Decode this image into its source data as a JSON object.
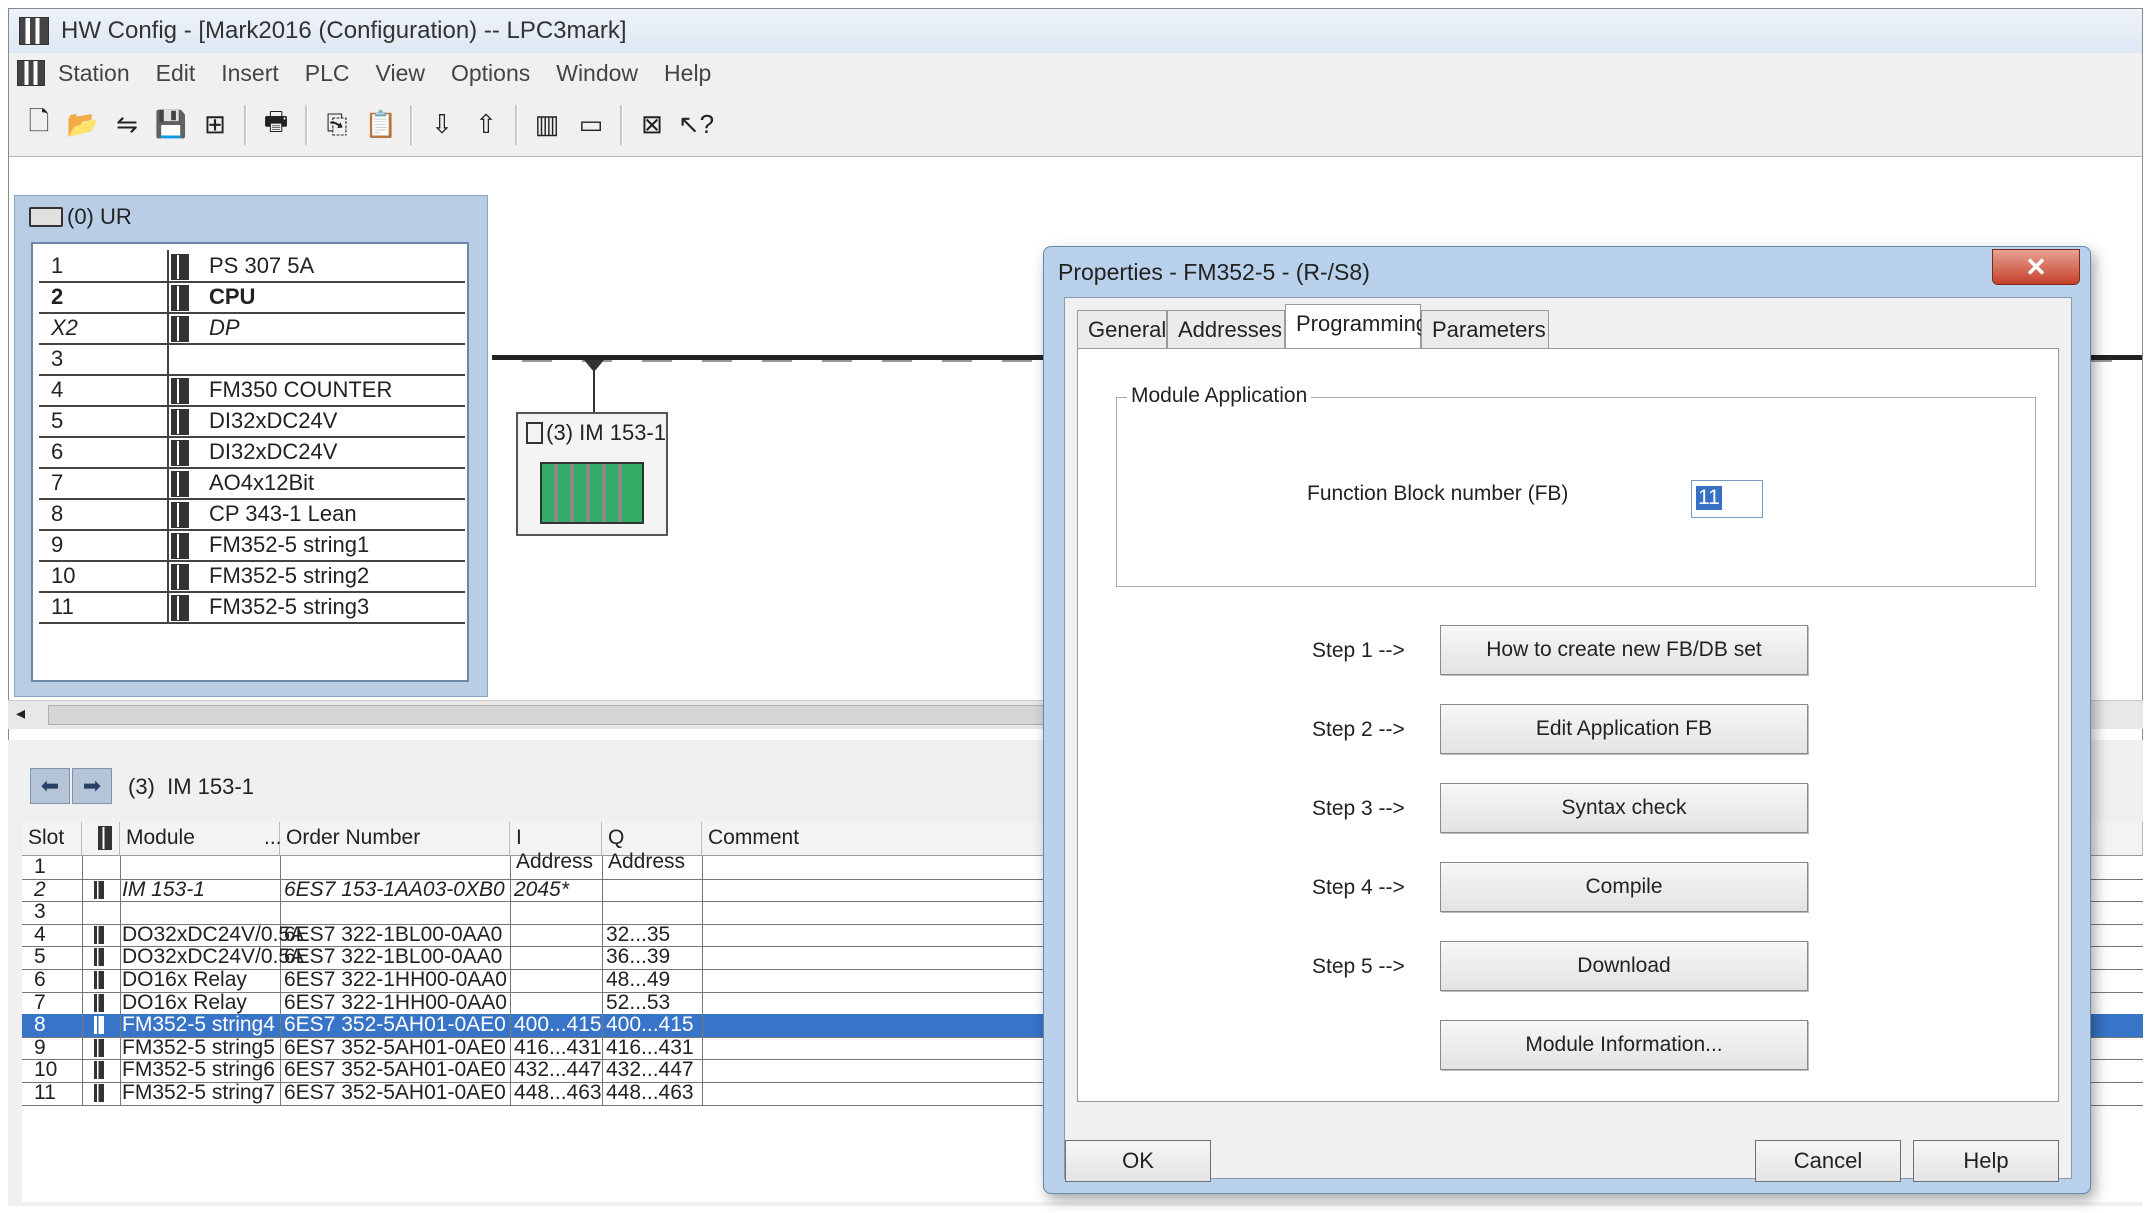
{
  "window": {
    "title": "HW Config - [Mark2016 (Configuration) -- LPC3mark]"
  },
  "menu": [
    "Station",
    "Edit",
    "Insert",
    "PLC",
    "View",
    "Options",
    "Window",
    "Help"
  ],
  "toolbar": [
    {
      "name": "new-icon",
      "glyph": "🗋"
    },
    {
      "name": "open-icon",
      "glyph": "📂"
    },
    {
      "name": "network-icon",
      "glyph": "⇋"
    },
    {
      "name": "save-icon",
      "glyph": "💾"
    },
    {
      "name": "save-compile-icon",
      "glyph": "⊞"
    },
    {
      "name": "sep"
    },
    {
      "name": "print-icon",
      "glyph": "🖶"
    },
    {
      "name": "sep"
    },
    {
      "name": "copy-icon",
      "glyph": "⎘"
    },
    {
      "name": "paste-icon",
      "glyph": "📋"
    },
    {
      "name": "sep"
    },
    {
      "name": "download-icon",
      "glyph": "⇩"
    },
    {
      "name": "upload-icon",
      "glyph": "⇧"
    },
    {
      "name": "sep"
    },
    {
      "name": "catalog-icon",
      "glyph": "▥"
    },
    {
      "name": "display-icon",
      "glyph": "▭"
    },
    {
      "name": "sep"
    },
    {
      "name": "netpro-icon",
      "glyph": "⊠"
    },
    {
      "name": "help-icon",
      "glyph": "↖?"
    }
  ],
  "rack": {
    "title": "(0) UR",
    "rows": [
      {
        "slot": "1",
        "module": "PS 307 5A"
      },
      {
        "slot": "2",
        "module": "CPU"
      },
      {
        "slot": "X2",
        "module": "DP"
      },
      {
        "slot": "3",
        "module": ""
      },
      {
        "slot": "4",
        "module": "FM350 COUNTER"
      },
      {
        "slot": "5",
        "module": "DI32xDC24V"
      },
      {
        "slot": "6",
        "module": "DI32xDC24V"
      },
      {
        "slot": "7",
        "module": "AO4x12Bit"
      },
      {
        "slot": "8",
        "module": "CP 343-1 Lean"
      },
      {
        "slot": "9",
        "module": "FM352-5 string1"
      },
      {
        "slot": "10",
        "module": "FM352-5 string2"
      },
      {
        "slot": "11",
        "module": "FM352-5 string3"
      }
    ]
  },
  "device": {
    "label": "(3) IM 153-1"
  },
  "lower": {
    "breadcrumb_num": "(3)",
    "breadcrumb_name": "IM 153-1",
    "headers": [
      "Slot",
      "",
      "Module",
      "...",
      "Order Number",
      "I Address",
      "Q Address",
      "Comment"
    ],
    "rows": [
      {
        "slot": "1",
        "module": "",
        "order": "",
        "i": "",
        "q": "",
        "style": ""
      },
      {
        "slot": "2",
        "module": "IM 153-1",
        "order": "6ES7 153-1AA03-0XB0",
        "i": "2045*",
        "q": "",
        "style": "it"
      },
      {
        "slot": "3",
        "module": "",
        "order": "",
        "i": "",
        "q": "",
        "style": ""
      },
      {
        "slot": "4",
        "module": "DO32xDC24V/0.5A",
        "order": "6ES7 322-1BL00-0AA0",
        "i": "",
        "q": "32...35",
        "style": ""
      },
      {
        "slot": "5",
        "module": "DO32xDC24V/0.5A",
        "order": "6ES7 322-1BL00-0AA0",
        "i": "",
        "q": "36...39",
        "style": ""
      },
      {
        "slot": "6",
        "module": "DO16x Relay",
        "order": "6ES7 322-1HH00-0AA0",
        "i": "",
        "q": "48...49",
        "style": ""
      },
      {
        "slot": "7",
        "module": "DO16x Relay",
        "order": "6ES7 322-1HH00-0AA0",
        "i": "",
        "q": "52...53",
        "style": ""
      },
      {
        "slot": "8",
        "module": "FM352-5 string4",
        "order": "6ES7 352-5AH01-0AE0",
        "i": "400...415",
        "q": "400...415",
        "style": "sel"
      },
      {
        "slot": "9",
        "module": "FM352-5 string5",
        "order": "6ES7 352-5AH01-0AE0",
        "i": "416...431",
        "q": "416...431",
        "style": ""
      },
      {
        "slot": "10",
        "module": "FM352-5 string6",
        "order": "6ES7 352-5AH01-0AE0",
        "i": "432...447",
        "q": "432...447",
        "style": ""
      },
      {
        "slot": "11",
        "module": "FM352-5 string7",
        "order": "6ES7 352-5AH01-0AE0",
        "i": "448...463",
        "q": "448...463",
        "style": ""
      }
    ]
  },
  "dialog": {
    "title": "Properties - FM352-5 - (R-/S8)",
    "close_glyph": "✕",
    "tabs": [
      "General",
      "Addresses",
      "Programming",
      "Parameters"
    ],
    "group_label": "Module Application",
    "fb_label": "Function Block number (FB)",
    "fb_value": "11",
    "steps": [
      {
        "label": "Step 1 -->",
        "button": "How to create new FB/DB set"
      },
      {
        "label": "Step 2 -->",
        "button": "Edit Application FB"
      },
      {
        "label": "Step 3 -->",
        "button": "Syntax check"
      },
      {
        "label": "Step 4 -->",
        "button": "Compile"
      },
      {
        "label": "Step 5 -->",
        "button": "Download"
      },
      {
        "label": "",
        "button": "Module Information..."
      }
    ],
    "ok": "OK",
    "cancel": "Cancel",
    "help": "Help"
  }
}
